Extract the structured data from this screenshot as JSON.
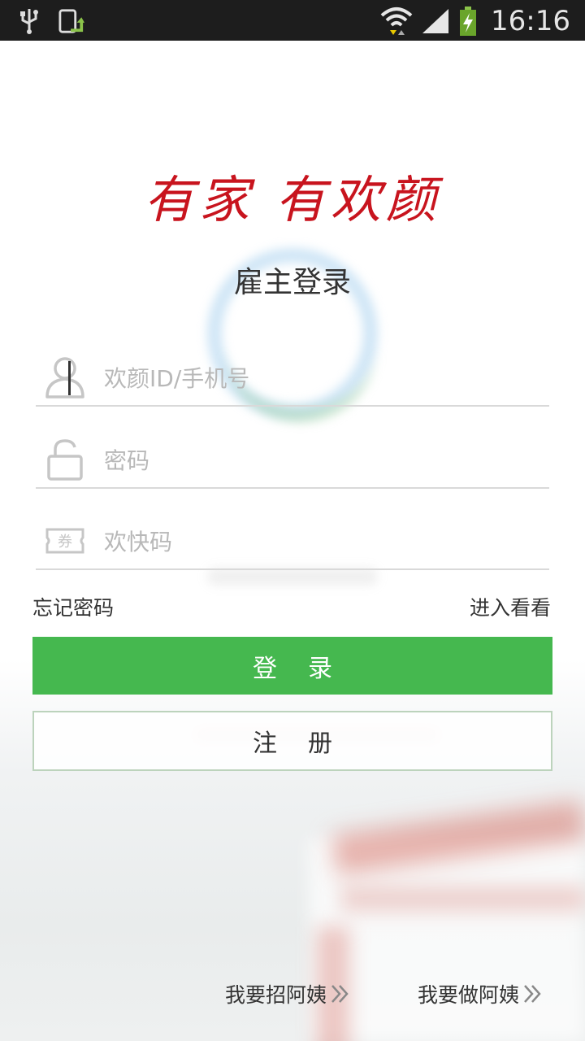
{
  "status_bar": {
    "time": "16:16",
    "icons": [
      "usb-icon",
      "screen-update-icon",
      "wifi-icon",
      "signal-icon",
      "battery-charging-icon"
    ]
  },
  "slogan": "有家 有欢颜",
  "page_title": "雇主登录",
  "form": {
    "username": {
      "placeholder": "欢颜ID/手机号",
      "value": "",
      "icon": "user-icon"
    },
    "password": {
      "placeholder": "密码",
      "value": "",
      "icon": "lock-icon"
    },
    "coupon": {
      "placeholder": "欢快码",
      "value": "",
      "icon": "coupon-icon"
    }
  },
  "links": {
    "forgot_password": "忘记密码",
    "browse": "进入看看"
  },
  "buttons": {
    "login": "登录",
    "register": "注册"
  },
  "bottom_links": {
    "hire": "我要招阿姨",
    "work": "我要做阿姨"
  },
  "colors": {
    "accent_green": "#45b84f",
    "slogan_red": "#c8141e",
    "status_bar_bg": "#1d1d1d"
  }
}
